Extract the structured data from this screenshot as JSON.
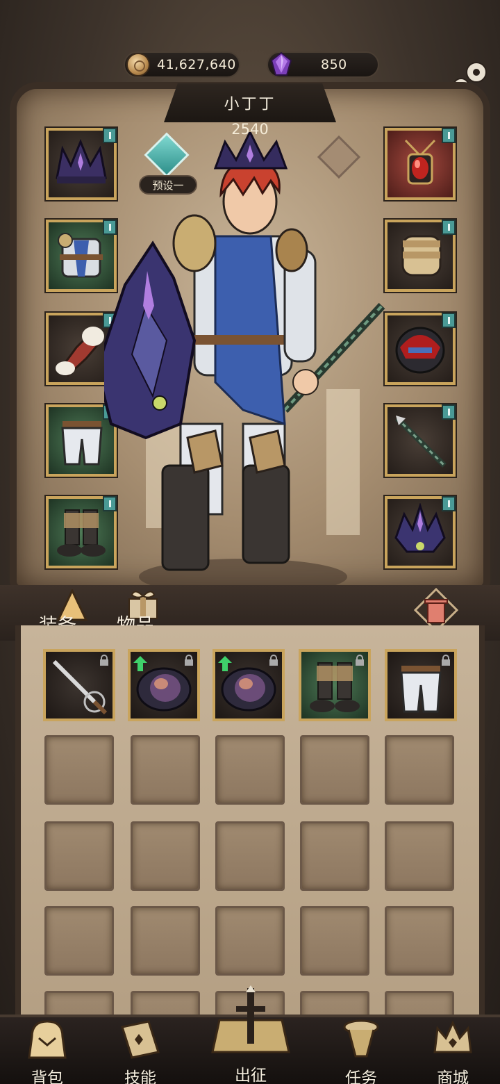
{
  "currency": {
    "gold": "41,627,640",
    "gold_icon": "coin-icon",
    "gems": "850",
    "gems_icon": "purple-crystal-icon"
  },
  "hero": {
    "name": "小丁丁",
    "power": "2540",
    "preset_label": "预设一"
  },
  "equipment_left": [
    {
      "name": "crown",
      "quality": "gold"
    },
    {
      "name": "chest-armor",
      "quality": "green"
    },
    {
      "name": "bracers",
      "quality": "gold"
    },
    {
      "name": "pants",
      "quality": "green"
    },
    {
      "name": "boots",
      "quality": "green"
    }
  ],
  "equipment_right": [
    {
      "name": "amulet",
      "quality": "red"
    },
    {
      "name": "gauntlet",
      "quality": "gold"
    },
    {
      "name": "helmet",
      "quality": "gold"
    },
    {
      "name": "staff",
      "quality": "gold"
    },
    {
      "name": "ring",
      "quality": "gold"
    }
  ],
  "tabs": {
    "equip": "装备",
    "items": "物品"
  },
  "inventory_items": [
    {
      "name": "rapier",
      "quality": "gold",
      "locked": true,
      "upgrade": false
    },
    {
      "name": "dark-shoulder",
      "quality": "gold",
      "locked": true,
      "upgrade": true
    },
    {
      "name": "dark-shoulder",
      "quality": "gold",
      "locked": true,
      "upgrade": true
    },
    {
      "name": "boots",
      "quality": "green",
      "locked": true,
      "upgrade": false
    },
    {
      "name": "pants",
      "quality": "green",
      "locked": true,
      "upgrade": false
    }
  ],
  "nav": {
    "bag": "背包",
    "skills": "技能",
    "battle": "出征",
    "quests": "任务",
    "shop": "商城"
  }
}
